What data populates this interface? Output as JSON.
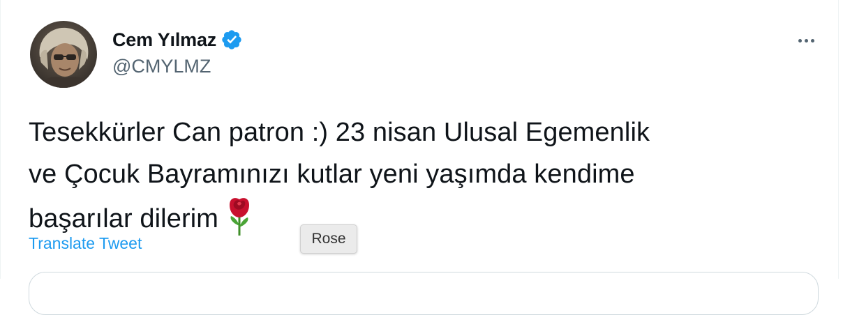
{
  "tweet": {
    "author_name": "Cem Yılmaz",
    "author_handle": "@CMYLMZ",
    "verified_icon": "verified-badge-icon",
    "more_icon": "more-options-icon",
    "text_lines": [
      "Tesekkürler Can patron :) 23 nisan Ulusal Egemenlik",
      "ve Çocuk Bayramınızı kutlar yeni yaşımda kendime",
      "başarılar dilerim"
    ],
    "emoji": "rose-icon",
    "translate_label": "Translate Tweet",
    "tooltip": "Rose"
  },
  "colors": {
    "text": "#0f1419",
    "secondary": "#536471",
    "link": "#1d9bf0",
    "verified": "#1d9bf0"
  }
}
